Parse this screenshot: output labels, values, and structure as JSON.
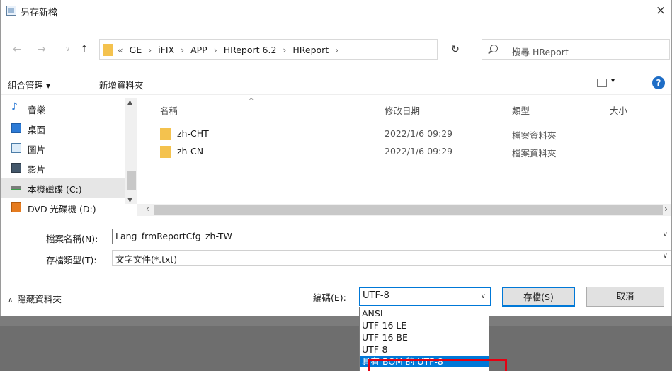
{
  "window": {
    "title": "另存新檔",
    "close_glyph": "×"
  },
  "address_bar": {
    "back_glyph": "←",
    "forward_glyph": "→",
    "recent_glyph": "∨",
    "up_glyph": "↑",
    "path": [
      "«",
      "GE",
      "›",
      "iFIX",
      "›",
      "APP",
      "›",
      "HReport 6.2",
      "›",
      "HReport",
      "›"
    ],
    "dropdown_glyph": "∨",
    "refresh_glyph": "↻",
    "search_placeholder": "搜尋 HReport"
  },
  "toolbar": {
    "organize": "組合管理 ▾",
    "new_folder": "新增資料夾",
    "view_drop": "▾",
    "help": "?"
  },
  "nav_pane": {
    "items": [
      {
        "label": "音樂",
        "icon": "music-icon"
      },
      {
        "label": "桌面",
        "icon": "desktop-icon"
      },
      {
        "label": "圖片",
        "icon": "pictures-icon"
      },
      {
        "label": "影片",
        "icon": "videos-icon"
      },
      {
        "label": "本機磁碟 (C:)",
        "icon": "drive-icon"
      },
      {
        "label": "DVD 光碟機 (D:)",
        "icon": "dvd-icon"
      }
    ],
    "selected_index": 4
  },
  "file_list": {
    "columns": [
      "名稱",
      "修改日期",
      "類型",
      "大小"
    ],
    "sort_caret": "^",
    "rows": [
      {
        "name": "zh-CHT",
        "modified": "2022/1/6 09:29",
        "type": "檔案資料夾"
      },
      {
        "name": "zh-CN",
        "modified": "2022/1/6 09:29",
        "type": "檔案資料夾"
      }
    ]
  },
  "form": {
    "filename_label": "檔案名稱(N):",
    "filename_value": "Lang_frmReportCfg_zh-TW",
    "filetype_label": "存檔類型(T):",
    "filetype_value": "文字文件(*.txt)",
    "drop_glyph": "∨"
  },
  "footer": {
    "hide_folders": "隱藏資料夾",
    "hide_caret": "∧",
    "encoding_label": "編碼(E):",
    "encoding_value": "UTF-8",
    "save_button": "存檔(S)",
    "cancel_button": "取消"
  },
  "encoding_options": [
    "ANSI",
    "UTF-16 LE",
    "UTF-16 BE",
    "UTF-8",
    "具有 BOM 的 UTF-8"
  ],
  "encoding_highlighted_index": 4,
  "colors": {
    "accent": "#0078d7",
    "highlight_box": "#e60012",
    "folder": "#f4c24e"
  }
}
